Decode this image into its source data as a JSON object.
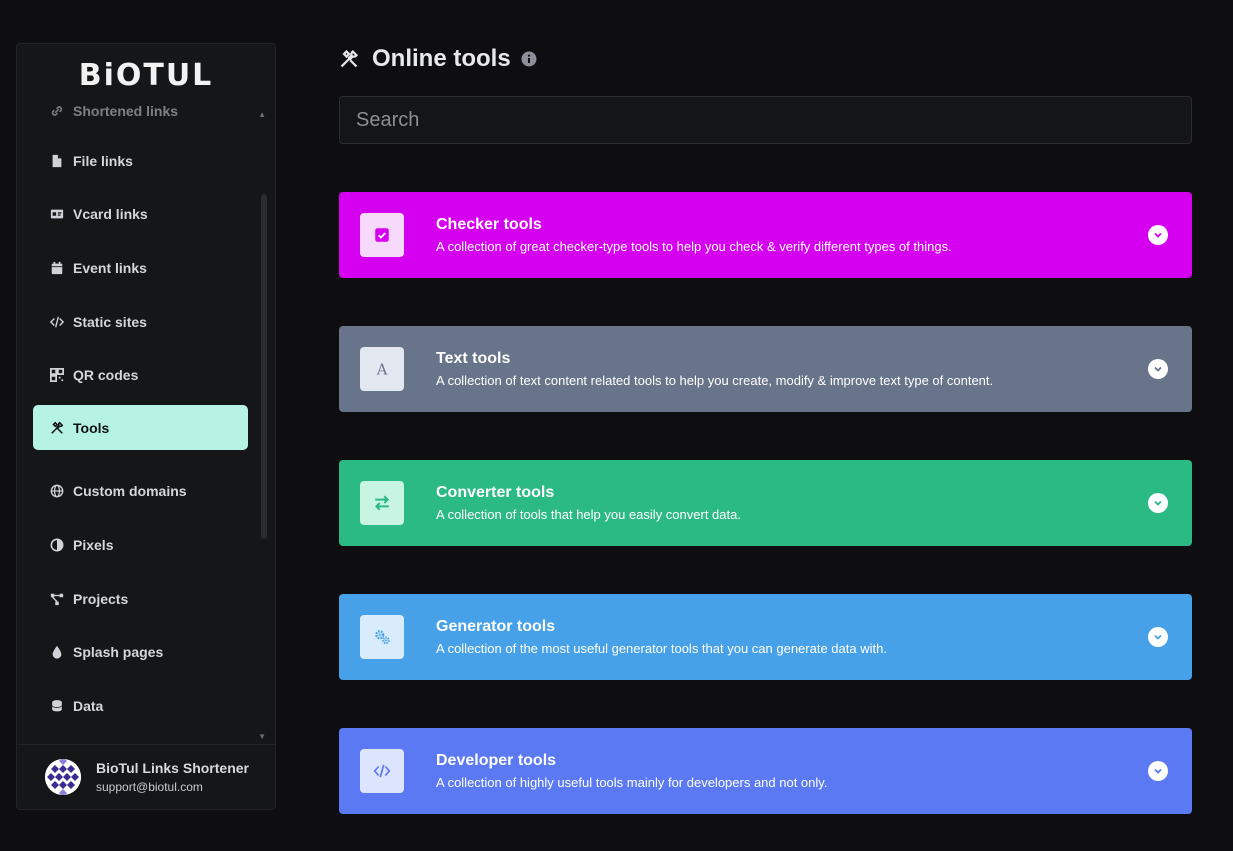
{
  "sidebar": {
    "logo": "BiOTUL",
    "items": [
      {
        "label": "Shortened links",
        "icon": "link-icon"
      },
      {
        "label": "File links",
        "icon": "file-icon"
      },
      {
        "label": "Vcard links",
        "icon": "id-card-icon"
      },
      {
        "label": "Event links",
        "icon": "calendar-icon"
      },
      {
        "label": "Static sites",
        "icon": "code-icon"
      },
      {
        "label": "QR codes",
        "icon": "qrcode-icon"
      },
      {
        "label": "Tools",
        "icon": "tools-icon",
        "active": true
      },
      {
        "label": "Custom domains",
        "icon": "globe-icon"
      },
      {
        "label": "Pixels",
        "icon": "adjust-icon"
      },
      {
        "label": "Projects",
        "icon": "project-diagram-icon"
      },
      {
        "label": "Splash pages",
        "icon": "droplet-icon"
      },
      {
        "label": "Data",
        "icon": "database-icon"
      }
    ],
    "user": {
      "name": "BioTul Links Shortener",
      "email": "support@biotul.com"
    }
  },
  "main": {
    "title": "Online tools",
    "search_placeholder": "Search",
    "categories": [
      {
        "title": "Checker tools",
        "desc": "A collection of great checker-type tools to help you check & verify different types of things.",
        "color": "#d500f0",
        "icon": "check-square-icon"
      },
      {
        "title": "Text tools",
        "desc": "A collection of text content related tools to help you create, modify & improve text type of content.",
        "color": "#677489",
        "icon": "font-icon"
      },
      {
        "title": "Converter tools",
        "desc": "A collection of tools that help you easily convert data.",
        "color": "#2bba84",
        "icon": "exchange-icon"
      },
      {
        "title": "Generator tools",
        "desc": "A collection of the most useful generator tools that you can generate data with.",
        "color": "#46a1e8",
        "icon": "cogs-icon"
      },
      {
        "title": "Developer tools",
        "desc": "A collection of highly useful tools mainly for developers and not only.",
        "color": "#5a79f2",
        "icon": "code-icon"
      }
    ]
  }
}
